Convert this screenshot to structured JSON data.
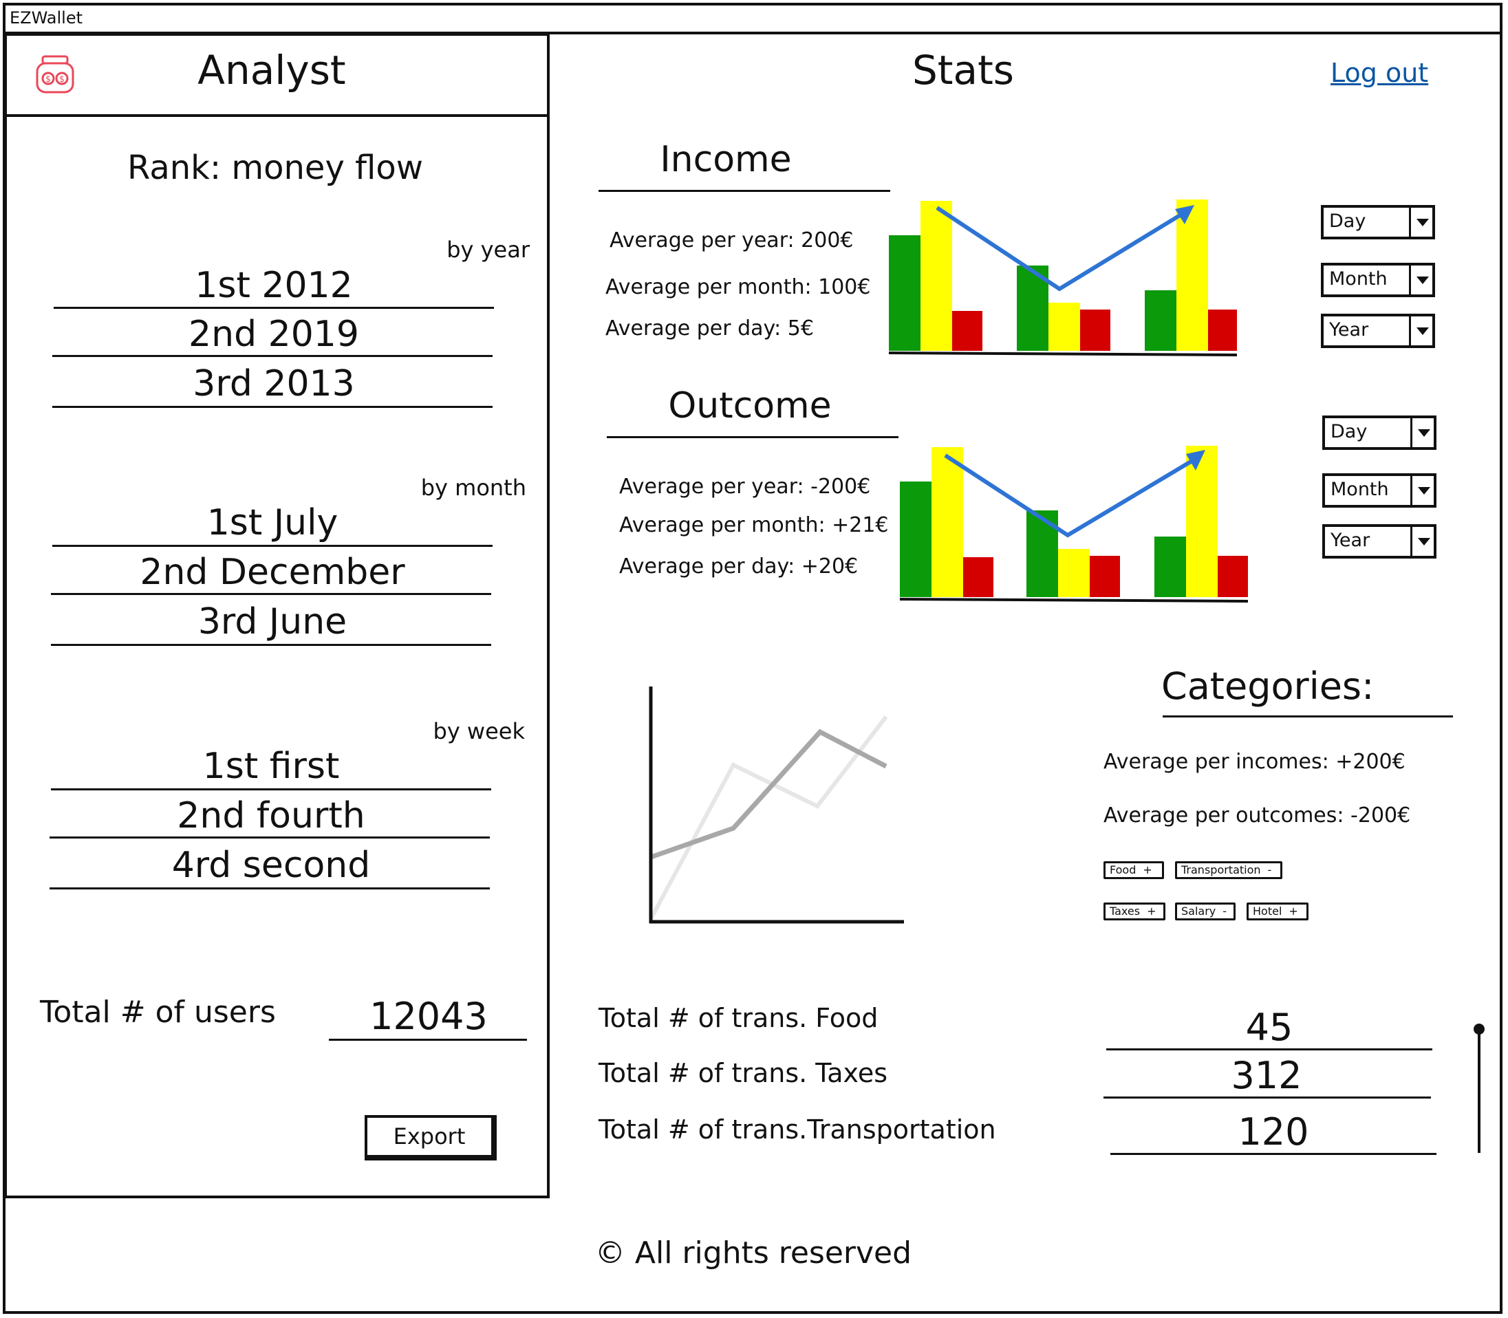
{
  "app": {
    "window_title": "EZWallet"
  },
  "sidebar": {
    "title": "Analyst",
    "rank_heading": "Rank: money flow",
    "groups": [
      {
        "label": "by year",
        "items": [
          "1st  2012",
          "2nd 2019",
          "3rd 2013"
        ]
      },
      {
        "label": "by month",
        "items": [
          "1st July",
          "2nd December",
          "3rd June"
        ]
      },
      {
        "label": "by week",
        "items": [
          "1st first",
          "2nd fourth",
          "4rd second"
        ]
      }
    ],
    "total_users_label": "Total # of users",
    "total_users_value": "12043",
    "export_label": "Export"
  },
  "main": {
    "title": "Stats",
    "logout_label": "Log out",
    "income": {
      "heading": "Income",
      "stats": [
        "Average per year: 200€",
        "Average per month: 100€",
        "Average per day: 5€"
      ],
      "dropdowns": [
        "Day",
        "Month",
        "Year"
      ]
    },
    "outcome": {
      "heading": "Outcome",
      "stats": [
        "Average per year: -200€",
        "Average per month: +21€",
        "Average per day: +20€"
      ],
      "dropdowns": [
        "Day",
        "Month",
        "Year"
      ]
    },
    "categories": {
      "heading": "Categories:",
      "avg_incomes": "Average per incomes: +200€",
      "avg_outcomes": "Average per outcomes: -200€",
      "tags": [
        {
          "label": "Food",
          "sign": "+"
        },
        {
          "label": "Transportation",
          "sign": "-"
        },
        {
          "label": "Taxes",
          "sign": "+"
        },
        {
          "label": "Salary",
          "sign": "-"
        },
        {
          "label": "Hotel",
          "sign": "+"
        }
      ]
    },
    "totals": [
      {
        "label": "Total # of trans. Food",
        "value": "45"
      },
      {
        "label": "Total # of trans. Taxes",
        "value": "312"
      },
      {
        "label": "Total # of trans.Transportation",
        "value": "120"
      }
    ],
    "footer": "© All rights reserved"
  },
  "colors": {
    "green": "#0a9a0a",
    "yellow": "#ffff00",
    "red": "#d40000",
    "trend": "#2e74d4",
    "link": "#0b56a4"
  }
}
